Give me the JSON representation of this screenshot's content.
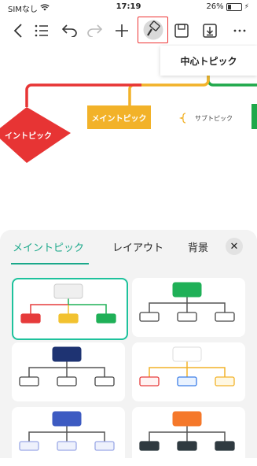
{
  "status_bar": {
    "carrier": "SIMなし",
    "time": "17:19",
    "battery": "26%",
    "battery_level": 0.26
  },
  "toolbar": {
    "icons": [
      "back-icon",
      "outline-icon",
      "undo-icon",
      "redo-icon",
      "add-icon",
      "format-brush-icon",
      "save-icon",
      "export-icon",
      "more-icon"
    ]
  },
  "canvas": {
    "center_topic": "中心トピック",
    "main_topic": "メイントピック",
    "sub_topic": "サブトピック",
    "diamond_topic": "イントピック",
    "colors": {
      "green": "#1fa84a",
      "yellow": "#f2b229",
      "red": "#e73434"
    }
  },
  "panel": {
    "tabs": [
      {
        "label": "メイントピック",
        "active": true
      },
      {
        "label": "レイアウト",
        "active": false
      },
      {
        "label": "背景",
        "active": false
      }
    ],
    "accent": "#1aa88a",
    "themes": [
      {
        "name": "rainbow",
        "root": "#efefef",
        "children": [
          "#e63b3b",
          "#f2c230",
          "#1fb057"
        ],
        "selected": true
      },
      {
        "name": "green",
        "root": "#1fb057",
        "children": [
          "#ffffff",
          "#ffffff",
          "#ffffff"
        ],
        "selected": false
      },
      {
        "name": "navy",
        "root": "#1e3372",
        "children": [
          "#ffffff",
          "#ffffff",
          "#ffffff"
        ],
        "selected": false
      },
      {
        "name": "colorful",
        "root": "#ffffff",
        "children": [
          "#fff3f3",
          "#eaf3ff",
          "#fff8e3"
        ],
        "selected": false
      },
      {
        "name": "blue",
        "root": "#3d5bc2",
        "children": [
          "#eef1fc",
          "#eef1fc",
          "#eef1fc"
        ],
        "selected": false
      },
      {
        "name": "orange",
        "root": "#f5782a",
        "children": [
          "#2f3a40",
          "#2f3a40",
          "#2f3a40"
        ],
        "selected": false
      }
    ]
  }
}
